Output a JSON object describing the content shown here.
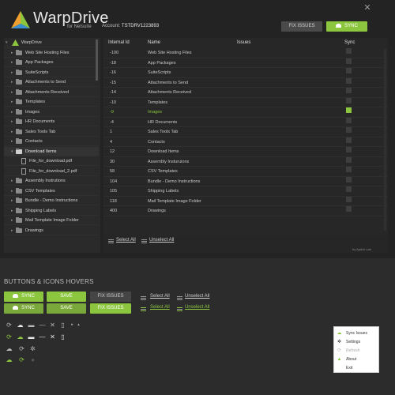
{
  "app": {
    "name": "WarpDrive",
    "subtitle": "for Netsuite",
    "account_label": "Account:",
    "account_id": "TSTDRV1223893"
  },
  "toolbar": {
    "fix_label": "FIX ISSUES",
    "sync_label": "SYNC"
  },
  "tree": {
    "root": "WarpDrive",
    "items": [
      "Web Site Hosting Files",
      "App Packages",
      "SuiteScripts",
      "Attachments to Send",
      "Attachments Received",
      "Templates",
      "Images",
      "HR Documents",
      "Sales Tools Tab",
      "Contacts",
      "Download Items",
      "File_for_download.pdf",
      "File_for_download_2.pdf",
      "Assembly Instrutions",
      "CSV Templates",
      "Bundle - Demo Instructions",
      "Shipping Labels",
      "Mail Template Image Folder",
      "Drawings"
    ]
  },
  "grid": {
    "headers": {
      "id": "Internal Id",
      "name": "Name",
      "issues": "Issues",
      "sync": "Sync"
    },
    "rows": [
      {
        "id": "-100",
        "name": "Web Site Hosting Files"
      },
      {
        "id": "-18",
        "name": "App Packages"
      },
      {
        "id": "-16",
        "name": "SuiteScripts"
      },
      {
        "id": "-15",
        "name": "Attachments to Send"
      },
      {
        "id": "-14",
        "name": "Attachments Received"
      },
      {
        "id": "-10",
        "name": "Templates"
      },
      {
        "id": "-9",
        "name": "Images"
      },
      {
        "id": "-4",
        "name": "HR Documents"
      },
      {
        "id": "1",
        "name": "Sales Tools Tab"
      },
      {
        "id": "4",
        "name": "Contacts"
      },
      {
        "id": "12",
        "name": "Download Items"
      },
      {
        "id": "30",
        "name": "Assembly Insturuions"
      },
      {
        "id": "58",
        "name": "CSV Templates"
      },
      {
        "id": "104",
        "name": "Bundle - Demo Instructions"
      },
      {
        "id": "105",
        "name": "Shipping Labels"
      },
      {
        "id": "118",
        "name": "Mail Template Image Folder"
      },
      {
        "id": "400",
        "name": "Drawings"
      }
    ],
    "select_all": "Select All",
    "unselect_all": "Unselect All",
    "byline": "by Apikin Lab"
  },
  "showcase": {
    "title": "BUTTONS & ICONS HOVERS",
    "sync": "SYNC",
    "save": "SAVE",
    "fix": "FIX ISSUES",
    "select_all": "Select All",
    "unselect_all": "Unselect All"
  },
  "menu": {
    "items": [
      "Sync Issues",
      "Settings",
      "Refresh",
      "About",
      "Exit"
    ]
  },
  "colors": {
    "accent": "#8cc63f",
    "window": "#232323",
    "page": "#2c2c2c"
  }
}
